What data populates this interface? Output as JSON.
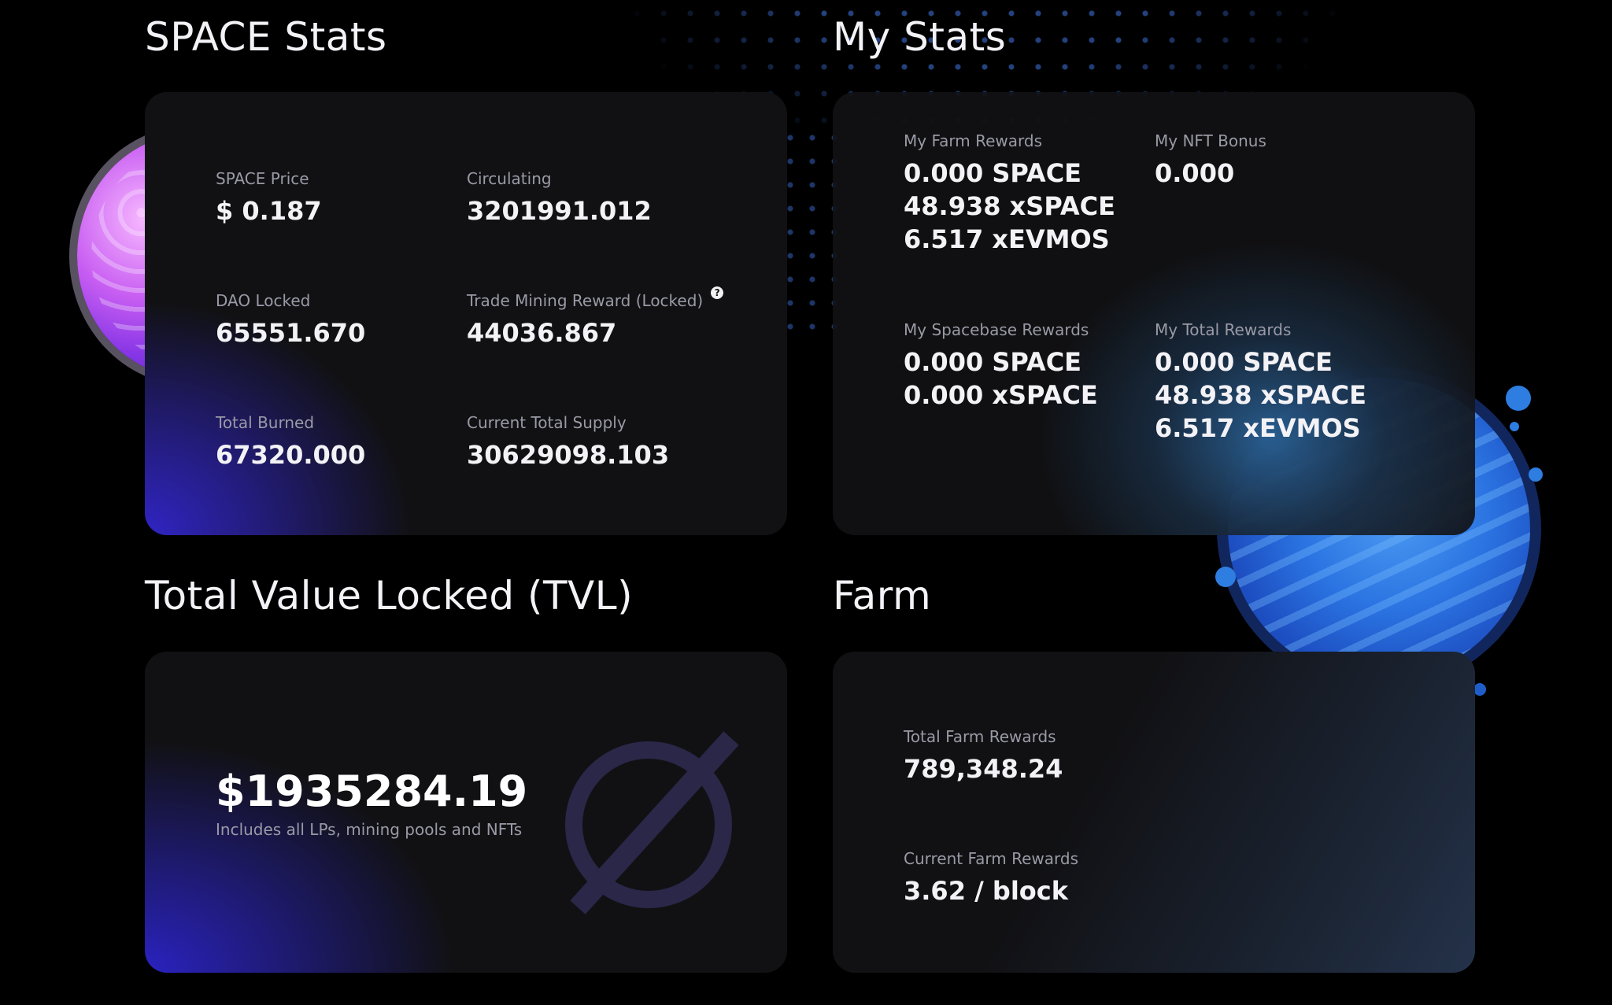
{
  "space_stats": {
    "title": "SPACE Stats",
    "items": [
      {
        "label": "SPACE Price",
        "value": "$ 0.187"
      },
      {
        "label": "Circulating",
        "value": "3201991.012"
      },
      {
        "label": "DAO Locked",
        "value": "65551.670"
      },
      {
        "label": "Trade Mining Reward (Locked)",
        "value": "44036.867"
      },
      {
        "label": "Total Burned",
        "value": "67320.000"
      },
      {
        "label": "Current Total Supply",
        "value": "30629098.103"
      }
    ],
    "help_glyph": "?"
  },
  "my_stats": {
    "title": "My Stats",
    "farm_rewards": {
      "label": "My Farm Rewards",
      "lines": [
        "0.000 SPACE",
        "48.938 xSPACE",
        "6.517 xEVMOS"
      ]
    },
    "nft_bonus": {
      "label": "My NFT Bonus",
      "lines": [
        "0.000"
      ]
    },
    "spacebase_rewards": {
      "label": "My Spacebase Rewards",
      "lines": [
        "0.000 SPACE",
        "0.000 xSPACE"
      ]
    },
    "total_rewards": {
      "label": "My Total Rewards",
      "lines": [
        "0.000 SPACE",
        "48.938 xSPACE",
        "6.517 xEVMOS"
      ]
    }
  },
  "tvl": {
    "title": "Total Value Locked (TVL)",
    "value": "$1935284.19",
    "note": "Includes all LPs, mining pools and NFTs",
    "icon": "null-symbol-icon"
  },
  "farm": {
    "title": "Farm",
    "total_label": "Total Farm Rewards",
    "total_value": "789,348.24",
    "current_label": "Current Farm Rewards",
    "current_value": "3.62 / block"
  },
  "colors": {
    "background": "#000000",
    "card": "#111114",
    "accent_purple": "#3024c4",
    "accent_blue": "#2e7de0",
    "label_gray": "#9a9aa6"
  }
}
